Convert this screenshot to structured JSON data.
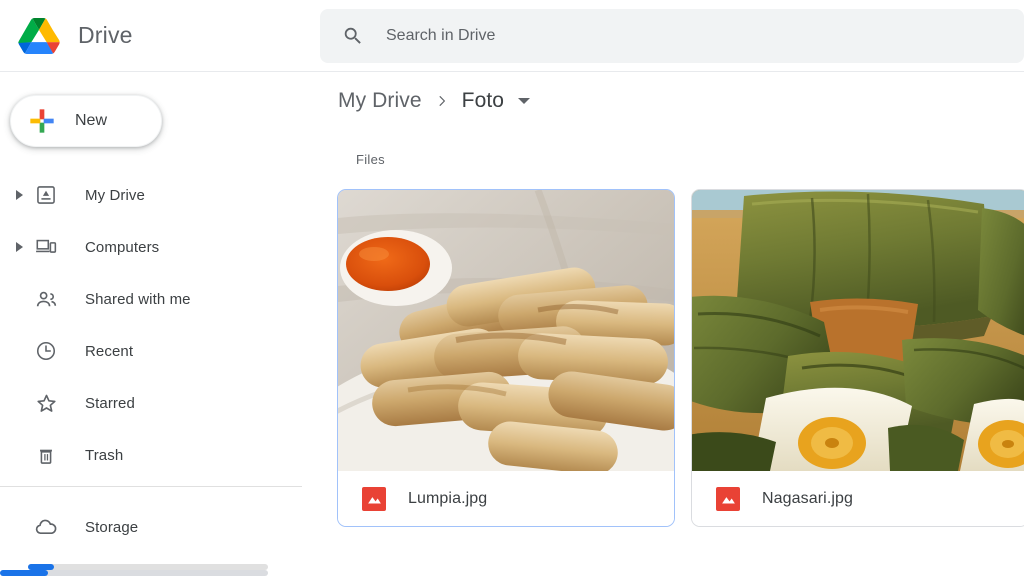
{
  "header": {
    "brand": "Drive",
    "logo_icon": "google-drive-logo",
    "search": {
      "icon": "search-icon",
      "placeholder": "Search in Drive",
      "value": ""
    }
  },
  "sidebar": {
    "new_button": {
      "label": "New",
      "icon": "plus-icon"
    },
    "items": [
      {
        "label": "My Drive",
        "icon": "my-drive-icon",
        "expandable": true
      },
      {
        "label": "Computers",
        "icon": "computers-icon",
        "expandable": true
      },
      {
        "label": "Shared with me",
        "icon": "shared-with-me-icon",
        "expandable": false
      },
      {
        "label": "Recent",
        "icon": "clock-icon",
        "expandable": false
      },
      {
        "label": "Starred",
        "icon": "star-icon",
        "expandable": false
      },
      {
        "label": "Trash",
        "icon": "trash-icon",
        "expandable": false
      }
    ],
    "storage": {
      "label": "Storage",
      "icon": "cloud-icon",
      "used_percent": 11
    }
  },
  "main": {
    "breadcrumb": {
      "root": "My Drive",
      "separator_icon": "chevron-right-icon",
      "current": "Foto",
      "caret_icon": "chevron-down-icon"
    },
    "section_title": "Files",
    "files": [
      {
        "name": "Lumpia.jpg",
        "icon": "image-file-icon",
        "selected": true,
        "thumbnail_alt": "Fried spring rolls on white plate with orange chili dipping sauce on wooden table"
      },
      {
        "name": "Nagasari.jpg",
        "icon": "image-file-icon",
        "selected": false,
        "thumbnail_alt": "Nagasari cakes wrapped in banana leaves with banana slice filling"
      }
    ]
  },
  "colors": {
    "accent": "#1a73e8",
    "selected_border": "#a1c2fa",
    "file_icon": "#e94235",
    "text_primary": "#3c4043",
    "text_secondary": "#5f6368",
    "search_bg": "#f1f3f4",
    "border": "#dadce0"
  }
}
